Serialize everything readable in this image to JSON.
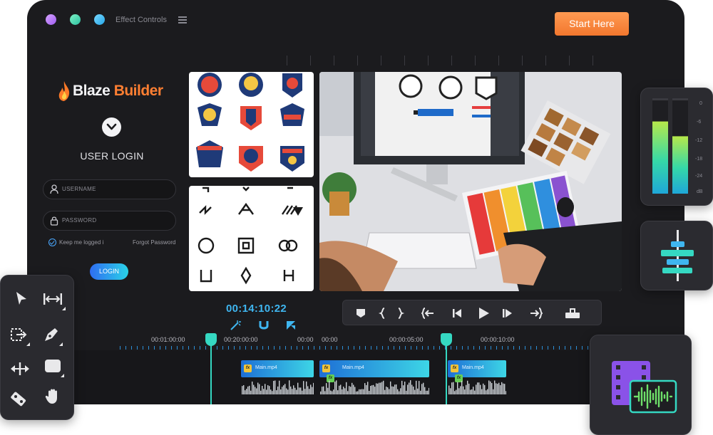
{
  "window": {
    "title": "Effect Controls",
    "cta_button": "Start Here"
  },
  "login": {
    "brand_part1": "Blaze",
    "brand_part2": " Builder",
    "title": "USER LOGIN",
    "username_placeholder": "USERNAME",
    "password_placeholder": "PASSWORD",
    "keep_logged_in": "Keep me logged i",
    "forgot_password": "Forgot Password",
    "login_button": "LOGIN"
  },
  "player": {
    "timecode": "00:14:10:22"
  },
  "timeline": {
    "time_labels": [
      "00:01:00:00",
      "00:20:00:00",
      "00:00",
      "00:00",
      "00:00:05:00",
      "00:00:10:00"
    ],
    "clips": [
      {
        "label": "Main.mp4",
        "fx": "fx"
      },
      {
        "label": "Main.mp4",
        "fx": "fx"
      },
      {
        "label": "Main.mp4",
        "fx": "fx"
      }
    ],
    "audio_fx": "fx"
  },
  "audio_meter": {
    "scale": [
      "0",
      "-6",
      "-12",
      "-18",
      "-24",
      "dB"
    ],
    "levels": [
      0.78,
      0.62
    ]
  },
  "colors": {
    "accent_orange": "#f2772e",
    "accent_cyan": "#35d8c2",
    "timecode_blue": "#3fb6f0",
    "window_bg": "#1b1b1e"
  },
  "icons": {
    "tool_palette": [
      "select-arrow-icon",
      "ripple-edit-icon",
      "slip-tool-icon",
      "pen-tool-icon",
      "move-tool-icon",
      "rectangle-tool-icon",
      "razor-tool-icon",
      "hand-tool-icon"
    ],
    "transport": [
      "marker-icon",
      "bracket-in-icon",
      "bracket-out-icon",
      "go-to-in-icon",
      "step-back-icon",
      "play-icon",
      "step-forward-icon",
      "go-to-out-icon",
      "export-frame-icon"
    ]
  }
}
